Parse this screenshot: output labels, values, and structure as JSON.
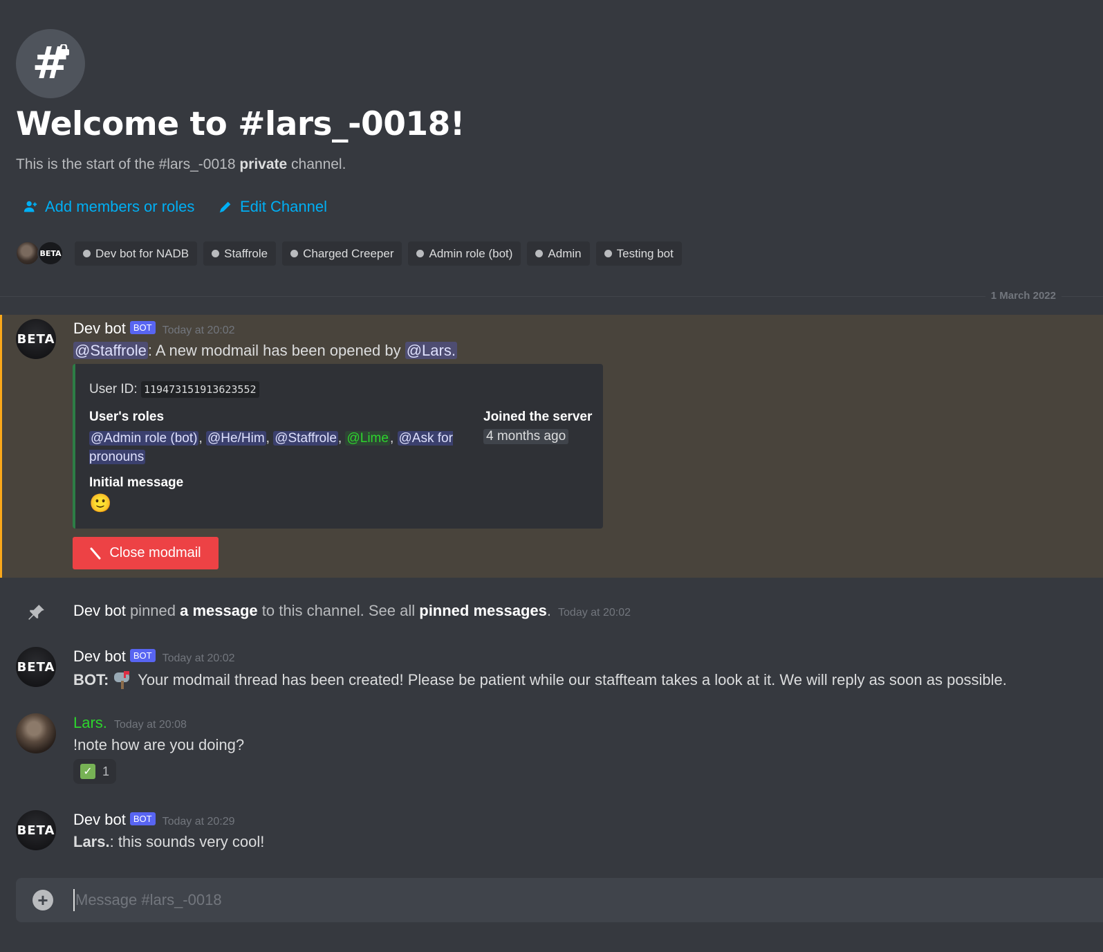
{
  "header": {
    "welcome_title": "Welcome to #lars_-0018!",
    "sub_prefix": "This is the start of the #lars_-0018 ",
    "sub_bold": "private",
    "sub_suffix": " channel.",
    "add_members_label": "Add members or roles",
    "edit_channel_label": "Edit Channel",
    "beta_badge": "BETA",
    "roles": [
      "Dev bot for NADB",
      "Staffrole",
      "Charged Creeper",
      "Admin role (bot)",
      "Admin",
      "Testing bot"
    ]
  },
  "date_divider": "1 March 2022",
  "messages": [
    {
      "author": "Dev bot",
      "bot_tag": "BOT",
      "time": "Today at 20:02",
      "mention_role": "@Staffrole",
      "text": ": A new modmail has been opened by ",
      "mention_user": "@Lars.",
      "avatar_text": "BETA",
      "embed": {
        "user_id_label": "User ID:",
        "user_id": "119473151913623552",
        "roles_label": "User's roles",
        "roles": [
          "@Admin role (bot)",
          "@He/Him",
          "@Staffrole",
          "@Lime",
          "@Ask for pronouns"
        ],
        "joined_label": "Joined the server",
        "joined_value": "4 months ago",
        "initial_label": "Initial message",
        "initial_emoji": "🙂"
      },
      "button": "Close modmail"
    },
    {
      "system": true,
      "author": "Dev bot",
      "t1": " pinned ",
      "t2": "a message",
      "t3": " to this channel. See all ",
      "t4": "pinned messages",
      "t5": ".",
      "time": "Today at 20:02"
    },
    {
      "author": "Dev bot",
      "bot_tag": "BOT",
      "time": "Today at 20:02",
      "avatar_text": "BETA",
      "bold_prefix": "BOT:",
      "text": " Your modmail thread has been created! Please be patient while our staffteam takes a look at it. We will reply as soon as possible."
    },
    {
      "author": "Lars.",
      "time": "Today at 20:08",
      "text": "!note how are you doing?",
      "reaction_count": "1"
    },
    {
      "author": "Dev bot",
      "bot_tag": "BOT",
      "time": "Today at 20:29",
      "avatar_text": "BETA",
      "bold_prefix": "Lars.",
      "text": ": this sounds very cool!"
    }
  ],
  "input": {
    "placeholder": "Message #lars_-0018"
  },
  "colors": {
    "background": "#36393f",
    "link": "#00aff4",
    "highlight": "#49443c",
    "highlight_border": "#faa81a",
    "bot_tag": "#5865f2",
    "lime": "#2dd52d",
    "close_button": "#ed4245",
    "embed_border": "#2d7d46"
  }
}
